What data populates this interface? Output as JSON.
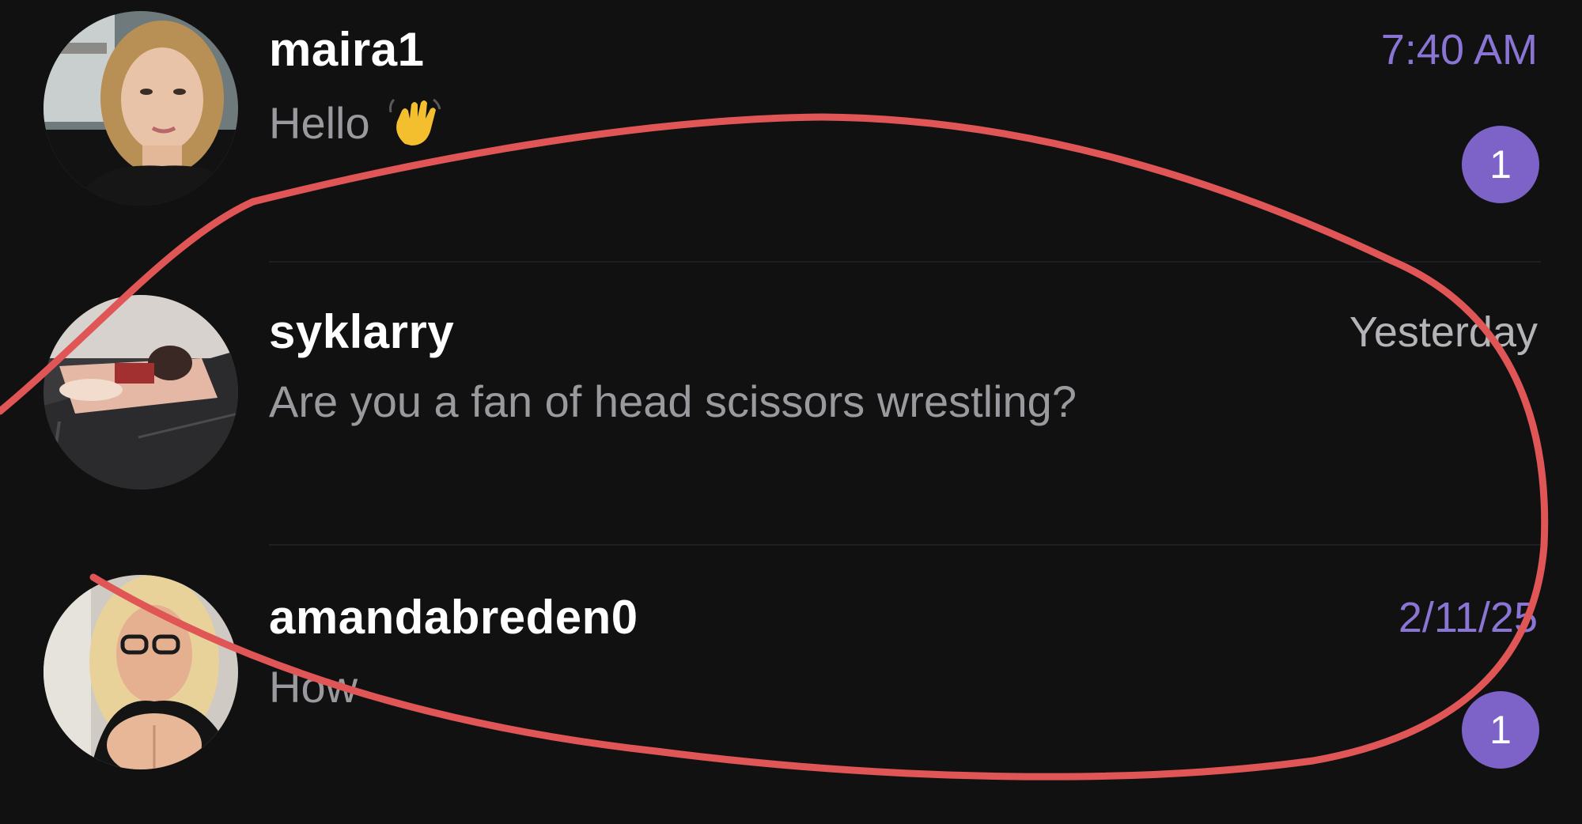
{
  "colors": {
    "background": "#111112",
    "accent": "#8a74d4",
    "badge": "#7d62c8",
    "muted_time": "#b4b4b8",
    "annotation": "#e05555"
  },
  "chats": [
    {
      "username": "maira1",
      "preview": "Hello",
      "preview_emoji": "waving-hand-icon",
      "timestamp": "7:40 AM",
      "timestamp_unread": true,
      "unread_count": "1"
    },
    {
      "username": "syklarry",
      "preview": "Are you a fan of head scissors wrestling?",
      "timestamp": "Yesterday",
      "timestamp_unread": false,
      "unread_count": ""
    },
    {
      "username": "amandabreden0",
      "preview": "How",
      "timestamp": "2/11/25",
      "timestamp_unread": true,
      "unread_count": "1"
    }
  ]
}
